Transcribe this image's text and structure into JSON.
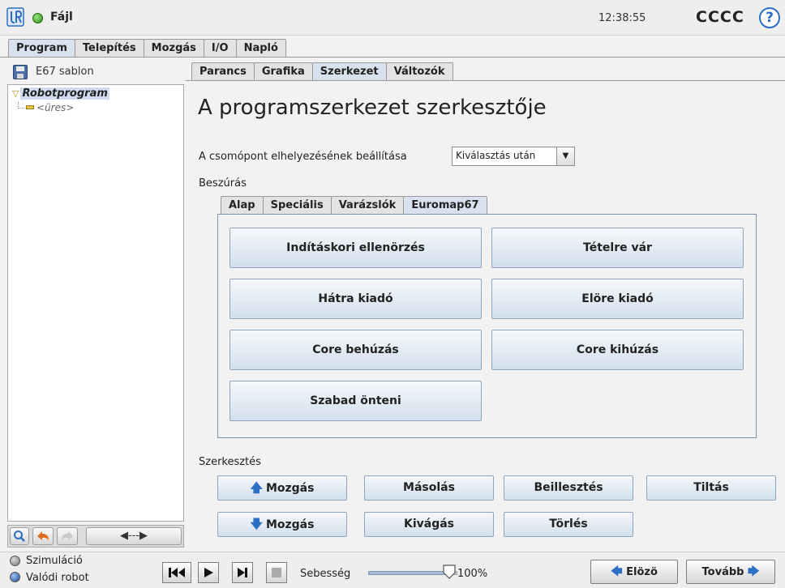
{
  "header": {
    "file_menu": "Fájl",
    "clock": "12:38:55",
    "robot_name": "CCCC",
    "help_symbol": "?"
  },
  "main_tabs": [
    {
      "label": "Program",
      "active": true
    },
    {
      "label": "Telepítés",
      "active": false
    },
    {
      "label": "Mozgás",
      "active": false
    },
    {
      "label": "I/O",
      "active": false
    },
    {
      "label": "Napló",
      "active": false
    }
  ],
  "left_panel": {
    "program_file": "E67 sablon",
    "tree_root": "Robotprogram",
    "tree_child": "<üres>",
    "tool_icons": [
      "search-icon",
      "undo-icon",
      "redo-icon",
      "move-left-right-icon"
    ],
    "move_symbol": "◀---▶"
  },
  "sub_tabs": [
    {
      "label": "Parancs",
      "active": false
    },
    {
      "label": "Grafika",
      "active": false
    },
    {
      "label": "Szerkezet",
      "active": true
    },
    {
      "label": "Változók",
      "active": false
    }
  ],
  "editor": {
    "title": "A programszerkezet szerkesztője",
    "placement_label": "A csomópont elhelyezésének beállítása",
    "placement_value": "Kiválasztás után",
    "insert_label": "Beszúrás",
    "insert_tabs": [
      {
        "label": "Alap",
        "active": false
      },
      {
        "label": "Speciális",
        "active": false
      },
      {
        "label": "Varázslók",
        "active": false
      },
      {
        "label": "Euromap67",
        "active": true
      }
    ],
    "insert_buttons": [
      "Indításkori ellenörzés",
      "Tételre vár",
      "Hátra kiadó",
      "Elöre kiadó",
      "Core behúzás",
      "Core kihúzás",
      "Szabad önteni"
    ],
    "edit_label": "Szerkesztés",
    "edit_buttons": {
      "move_up": "Mozgás",
      "copy": "Másolás",
      "paste": "Beillesztés",
      "disable": "Tiltás",
      "move_down": "Mozgás",
      "cut": "Kivágás",
      "delete": "Törlés"
    }
  },
  "footer": {
    "simulation": "Szimuláció",
    "real_robot": "Valódi robot",
    "speed_label": "Sebesség",
    "speed_value": "100%",
    "speed_fraction": 1.0,
    "prev": "Elözö",
    "next": "Tovább"
  },
  "colors": {
    "accent_blue": "#2d6fc4",
    "status_green": "#2c8a18",
    "selection": "#cfdcef"
  }
}
